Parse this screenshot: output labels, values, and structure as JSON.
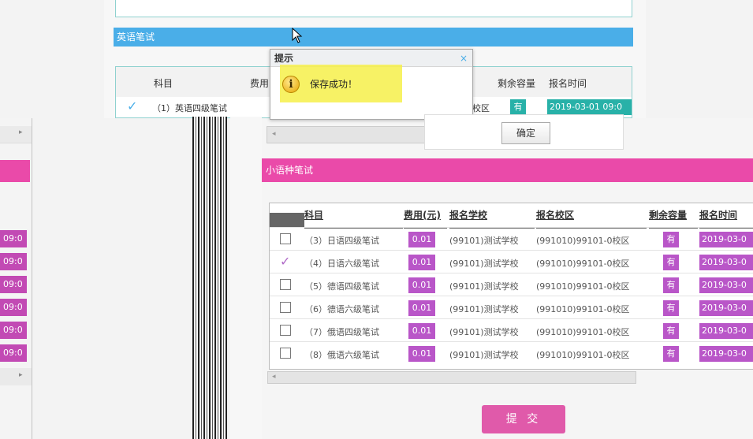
{
  "english_section": {
    "title": "英语笔试",
    "columns": {
      "subject": "科目",
      "fee": "费用",
      "remaining": "剩余容量",
      "time": "报名时间"
    },
    "row": {
      "name": "（1）英语四级笔试",
      "campus_tail": "校区",
      "capacity": "有",
      "time": "2019-03-01 09:0"
    }
  },
  "dialog": {
    "title": "提示",
    "close": "×",
    "message": "保存成功！",
    "confirm": "确定"
  },
  "left_times": [
    "09:0",
    "09:0",
    "09:0",
    "09:0",
    "09:0",
    "09:0"
  ],
  "minor_section": {
    "title": "小语种笔试",
    "columns": {
      "subject": "科目",
      "fee": "费用(元)",
      "school": "报名学校",
      "campus": "报名校区",
      "remaining": "剩余容量",
      "time": "报名时间"
    },
    "rows": [
      {
        "checked": false,
        "name": "（3）日语四级笔试",
        "fee": "0.01",
        "school": "(99101)测试学校",
        "campus": "(991010)99101-0校区",
        "capacity": "有",
        "time": "2019-03-0"
      },
      {
        "checked": true,
        "name": "（4）日语六级笔试",
        "fee": "0.01",
        "school": "(99101)测试学校",
        "campus": "(991010)99101-0校区",
        "capacity": "有",
        "time": "2019-03-0"
      },
      {
        "checked": false,
        "name": "（5）德语四级笔试",
        "fee": "0.01",
        "school": "(99101)测试学校",
        "campus": "(991010)99101-0校区",
        "capacity": "有",
        "time": "2019-03-0"
      },
      {
        "checked": false,
        "name": "（6）德语六级笔试",
        "fee": "0.01",
        "school": "(99101)测试学校",
        "campus": "(991010)99101-0校区",
        "capacity": "有",
        "time": "2019-03-0"
      },
      {
        "checked": false,
        "name": "（7）俄语四级笔试",
        "fee": "0.01",
        "school": "(99101)测试学校",
        "campus": "(991010)99101-0校区",
        "capacity": "有",
        "time": "2019-03-0"
      },
      {
        "checked": false,
        "name": "（8）俄语六级笔试",
        "fee": "0.01",
        "school": "(99101)测试学校",
        "campus": "(991010)99101-0校区",
        "capacity": "有",
        "time": "2019-03-0"
      }
    ]
  },
  "submit_label": "提 交",
  "colors": {
    "blue_header": "#4aaee8",
    "pink_header": "#ea4aa9",
    "badge_purple": "#b956c8",
    "highlight": "#f6f04a"
  }
}
